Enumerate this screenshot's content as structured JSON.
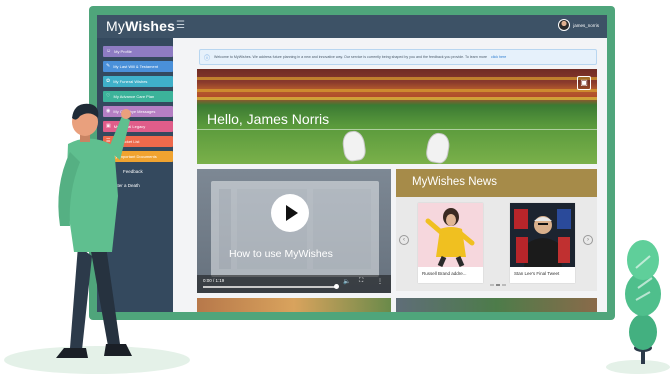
{
  "app": {
    "logo_regular": "My",
    "logo_bold": "Wishes",
    "user_name": "james_norris"
  },
  "sidebar": {
    "items": [
      {
        "label": "My Profile",
        "color": "#8e7cc3"
      },
      {
        "label": "My Last Will & Testament",
        "color": "#4a90d9"
      },
      {
        "label": "My Funeral Wishes",
        "color": "#3fb0c9"
      },
      {
        "label": "My Advance Care Plan",
        "color": "#3cb39a"
      },
      {
        "label": "My Goodbye Messages",
        "color": "#b57fc4"
      },
      {
        "label": "My Digital Legacy",
        "color": "#e05d8a"
      },
      {
        "label": "My Bucket List",
        "color": "#ef6a4c"
      },
      {
        "label": "My Important Documents",
        "color": "#f0a330"
      }
    ],
    "feedback_label": "Feedback",
    "register_death_label": "Register a Death"
  },
  "welcome": {
    "text": "Welcome to MyWishes. We address future planning in a new and innovative way. Our service is currently being shaped by you and the feedback you provide. To learn more",
    "link_label": "click here"
  },
  "hero": {
    "greeting": "Hello, James Norris"
  },
  "video": {
    "title": "How to use MyWishes",
    "time": "0:00 / 1:19"
  },
  "news": {
    "heading": "MyWishes News",
    "articles": [
      {
        "caption": "Russell Brand addre..."
      },
      {
        "caption": "Stan Lee's Final Tweet"
      }
    ]
  },
  "colors": {
    "monitor_frame": "#4fa57b",
    "header": "#3d5266",
    "sidebar": "#34495e",
    "news_header": "#a68b49",
    "figure_shirt": "#5fbf8f",
    "figure_trousers": "#2c3a4a",
    "plant_green": "#4fbf8c"
  }
}
